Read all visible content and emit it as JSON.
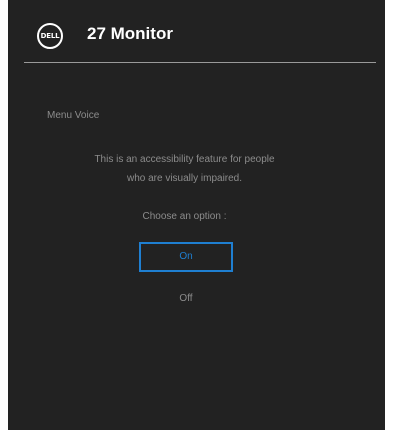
{
  "header": {
    "logo_text": "DELL",
    "title": "27 Monitor"
  },
  "menu_voice": {
    "label": "Menu Voice",
    "description_line1": "This is an accessibility feature for people",
    "description_line2": "who are visually impaired.",
    "prompt": "Choose an option :",
    "options": [
      {
        "label": "On",
        "selected": true
      },
      {
        "label": "Off",
        "selected": false
      }
    ]
  },
  "colors": {
    "background": "#222222",
    "accent": "#1f7fd1",
    "text_dim": "#8c8c8c"
  }
}
